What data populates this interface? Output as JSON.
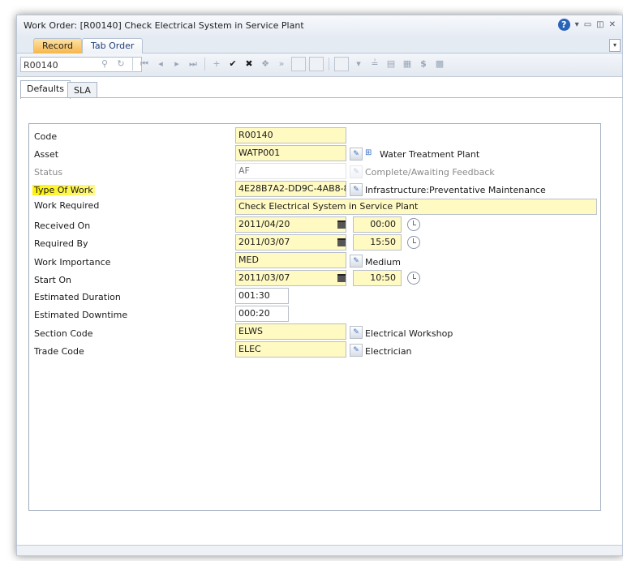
{
  "window": {
    "title": "Work Order: [R00140] Check Electrical System in Service Plant"
  },
  "ribbon": {
    "tabs": [
      "Record",
      "Tab Order"
    ]
  },
  "toolbar": {
    "record_id": "R00140"
  },
  "subtabs": [
    "Defaults",
    "SLA"
  ],
  "form": {
    "code": {
      "label": "Code",
      "value": "R00140"
    },
    "asset": {
      "label": "Asset",
      "value": "WATP001",
      "desc": "Water Treatment Plant"
    },
    "status": {
      "label": "Status",
      "value": "AF",
      "desc": "Complete/Awaiting Feedback"
    },
    "type_of_work": {
      "label": "Type Of Work",
      "value": "4E28B7A2-DD9C-4AB8-8",
      "desc": "Infrastructure:Preventative Maintenance"
    },
    "work_required": {
      "label": "Work Required",
      "value": "Check Electrical System in Service Plant"
    },
    "received_on": {
      "label": "Received On",
      "date": "2011/04/20",
      "time": "00:00"
    },
    "required_by": {
      "label": "Required By",
      "date": "2011/03/07",
      "time": "15:50"
    },
    "work_importance": {
      "label": "Work Importance",
      "value": "MED",
      "desc": "Medium"
    },
    "start_on": {
      "label": "Start On",
      "date": "2011/03/07",
      "time": "10:50"
    },
    "estimated_duration": {
      "label": "Estimated Duration",
      "value": "001:30"
    },
    "estimated_downtime": {
      "label": "Estimated Downtime",
      "value": "000:20"
    },
    "section_code": {
      "label": "Section Code",
      "value": "ELWS",
      "desc": "Electrical Workshop"
    },
    "trade_code": {
      "label": "Trade Code",
      "value": "ELEC",
      "desc": "Electrician"
    }
  },
  "colors": {
    "field_yellow": "#fff9c2",
    "active_tab": "#f6b64a",
    "highlight": "#fff200"
  }
}
